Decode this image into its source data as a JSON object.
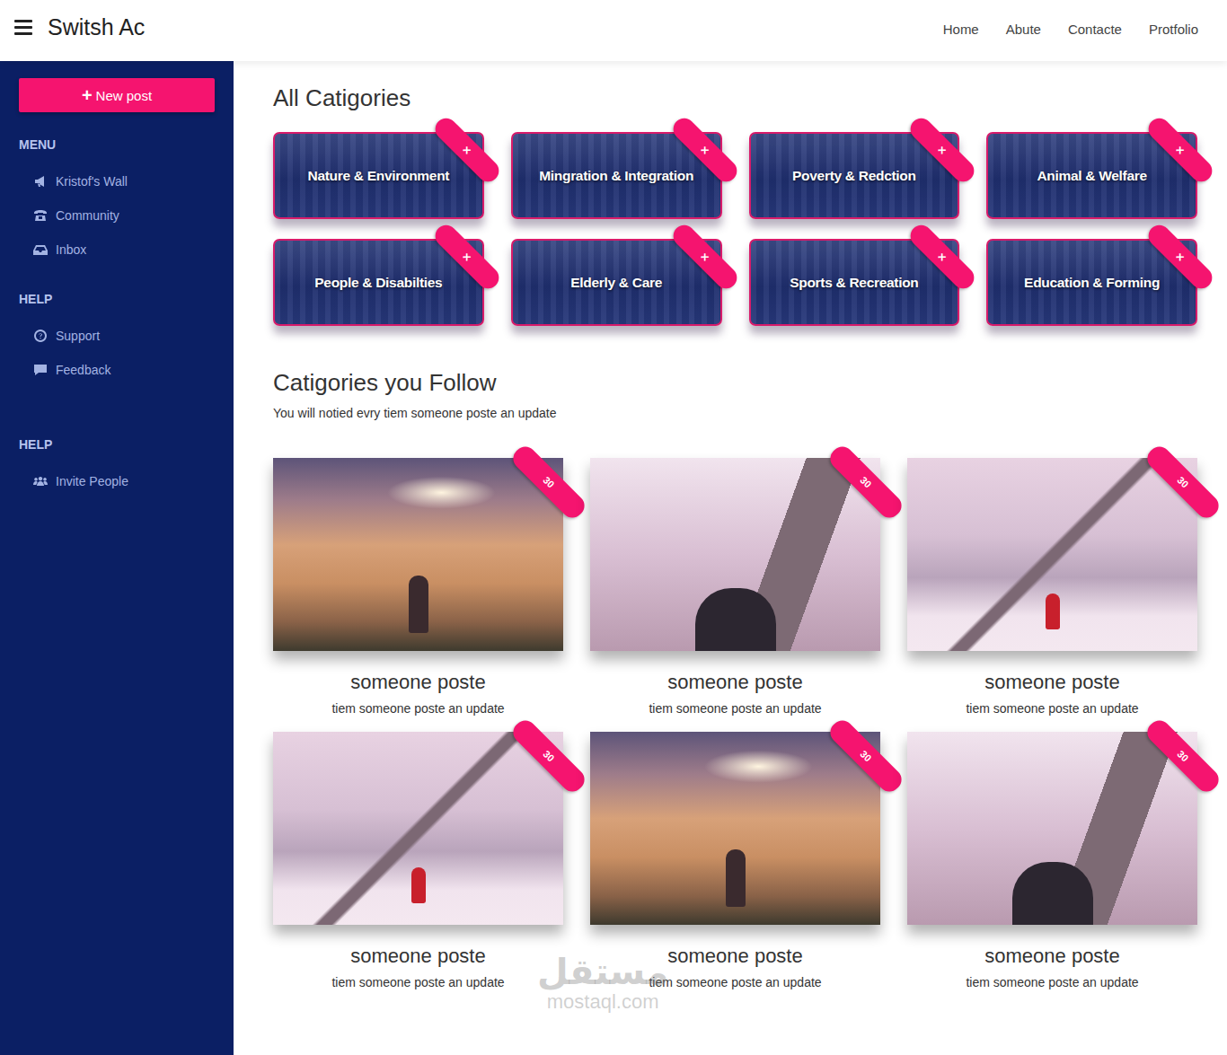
{
  "navbar": {
    "title": "Switsh Ac",
    "links": [
      "Home",
      "Abute",
      "Contacte",
      "Protfolio"
    ]
  },
  "sidebar": {
    "new_post": {
      "icon": "+",
      "label": "New post"
    },
    "sections": [
      {
        "title": "MENU",
        "items": [
          "Kristof's Wall",
          "Community",
          "Inbox"
        ]
      },
      {
        "title": "HELP",
        "items": [
          "Support",
          "Feedback"
        ]
      },
      {
        "title": "HELP",
        "items": [
          "Invite People"
        ]
      }
    ]
  },
  "all_categories": {
    "title": "All Catigories",
    "items": [
      {
        "label": "Nature & Environment",
        "close": "×"
      },
      {
        "label": "Mingration & Integration",
        "close": "×"
      },
      {
        "label": "Poverty & Redction",
        "close": "×"
      },
      {
        "label": "Animal & Welfare",
        "close": "×"
      },
      {
        "label": "People & Disabilties",
        "close": "×"
      },
      {
        "label": "Elderly & Care",
        "close": "×"
      },
      {
        "label": "Sports & Recreation",
        "close": "×"
      },
      {
        "label": "Education & Forming",
        "close": "×"
      }
    ]
  },
  "followed": {
    "title": "Catigories you Follow",
    "subtitle": "You will notied evry tiem someone poste an update",
    "items": [
      {
        "title": "someone poste",
        "text": "tiem someone poste an update",
        "badge": "30",
        "kind": "clouds"
      },
      {
        "title": "someone poste",
        "text": "tiem someone poste an update",
        "badge": "30",
        "kind": "city"
      },
      {
        "title": "someone poste",
        "text": "tiem someone poste an update",
        "badge": "30",
        "kind": "mountain"
      },
      {
        "title": "someone poste",
        "text": "tiem someone poste an update",
        "badge": "30",
        "kind": "mountain"
      },
      {
        "title": "someone poste",
        "text": "tiem someone poste an update",
        "badge": "30",
        "kind": "clouds"
      },
      {
        "title": "someone poste",
        "text": "tiem someone poste an update",
        "badge": "30",
        "kind": "city"
      }
    ]
  },
  "watermark": {
    "arabic": "مستقل",
    "latin": "mostaql.com"
  }
}
